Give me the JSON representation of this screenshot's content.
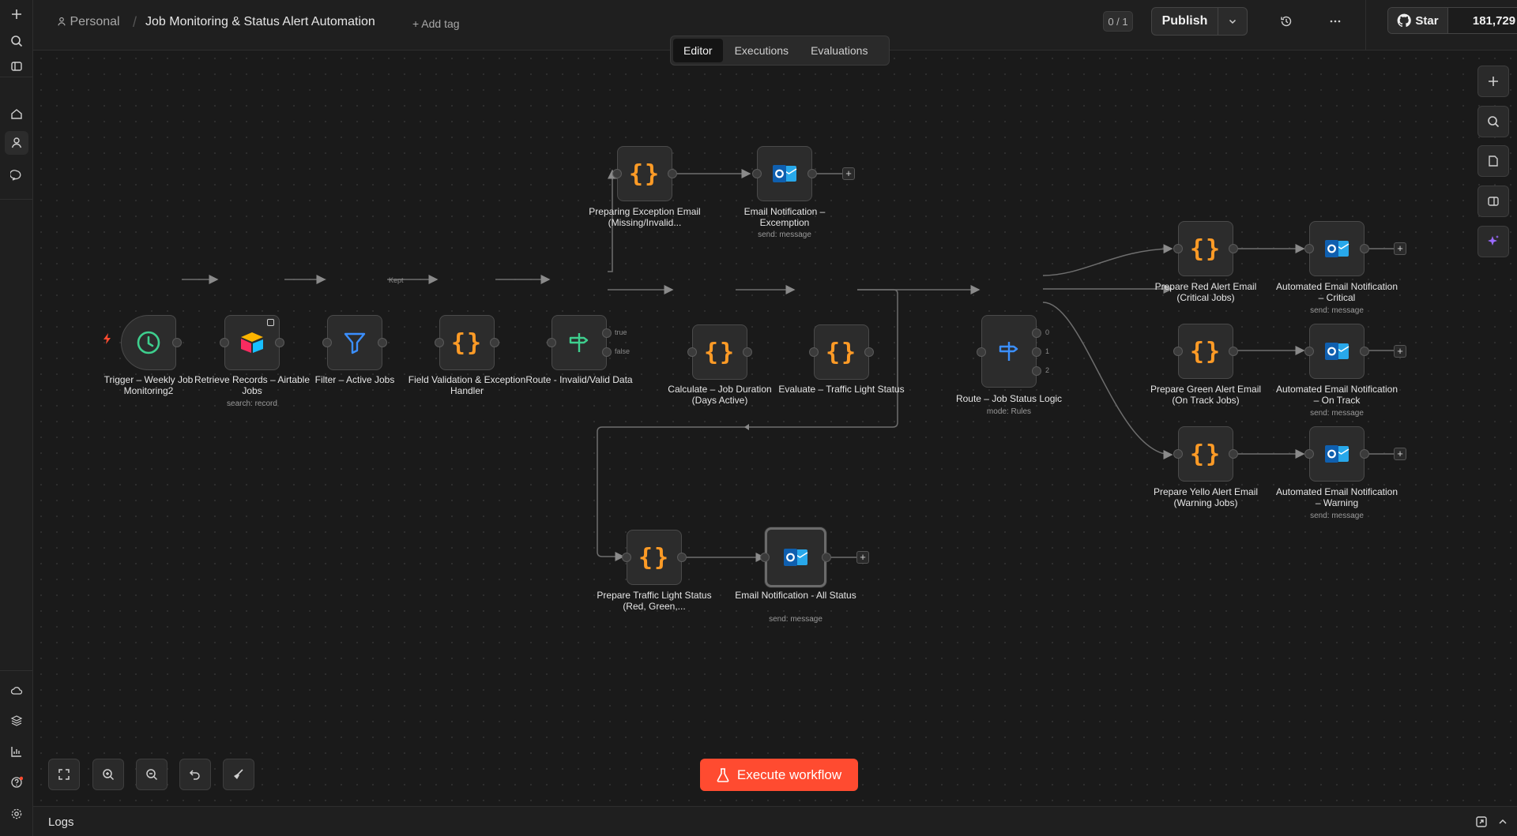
{
  "breadcrumb": {
    "project": "Personal",
    "separator": "/",
    "workflow_title": "Job Monitoring & Status Alert Automation",
    "add_tag": "+ Add tag"
  },
  "header": {
    "counter": "0 / 1",
    "publish_label": "Publish",
    "github_star_label": "Star",
    "github_star_count": "181,729"
  },
  "tabs": [
    {
      "label": "Editor",
      "active": true
    },
    {
      "label": "Executions"
    },
    {
      "label": "Evaluations"
    }
  ],
  "nodes": {
    "trigger": {
      "label": "Trigger – Weekly Job Monitoring2",
      "icon": "clock-icon"
    },
    "retrieve": {
      "label": "Retrieve Records – Airtable Jobs",
      "sub": "search: record",
      "icon": "airtable-icon"
    },
    "filter": {
      "label": "Filter – Active Jobs",
      "icon": "filter-icon"
    },
    "validation": {
      "label": "Field Validation & Exception Handler",
      "icon": "code-icon"
    },
    "route_valid": {
      "label": "Route - Invalid/Valid Data",
      "icon": "route-icon",
      "out_true": "true",
      "out_false": "false"
    },
    "prep_exception": {
      "label": "Preparing Exception Email (Missing/Invalid...",
      "icon": "code-icon"
    },
    "email_exception": {
      "label": "Email Notification – Excemption",
      "sub": "send: message",
      "icon": "outlook-icon"
    },
    "calc_duration": {
      "label": "Calculate – Job Duration (Days Active)",
      "icon": "code-icon"
    },
    "evaluate": {
      "label": "Evaluate – Traffic Light Status",
      "icon": "code-icon"
    },
    "route_status": {
      "label": "Route – Job Status Logic",
      "sub": "mode: Rules",
      "icon": "route-icon",
      "out_0": "0",
      "out_1": "1",
      "out_2": "2"
    },
    "prep_red": {
      "label": "Prepare Red Alert Email (Critical Jobs)",
      "icon": "code-icon"
    },
    "email_critical": {
      "label": "Automated Email Notification – Critical",
      "sub": "send: message",
      "icon": "outlook-icon"
    },
    "prep_green": {
      "label": "Prepare Green Alert Email (On Track Jobs)",
      "icon": "code-icon"
    },
    "email_ontrack": {
      "label": "Automated Email Notification – On Track",
      "sub": "send: message",
      "icon": "outlook-icon"
    },
    "prep_yellow": {
      "label": "Prepare Yello Alert Email (Warning Jobs)",
      "icon": "code-icon"
    },
    "email_warning": {
      "label": "Automated Email Notification – Warning",
      "sub": "send: message",
      "icon": "outlook-icon"
    },
    "prep_traffic": {
      "label": "Prepare Traffic Light Status (Red, Green,...",
      "icon": "code-icon"
    },
    "email_all": {
      "label": "Email Notification - All Status",
      "sub": "send: message",
      "icon": "outlook-icon"
    }
  },
  "edge_labels": {
    "kept": "Kept"
  },
  "execute_label": "Execute workflow",
  "logs_label": "Logs",
  "colors": {
    "accent": "#ff4b30",
    "code": "#ff9b26",
    "trigger": "#3ecf8e",
    "filter": "#3b8fff",
    "route_green": "#3ecf8e",
    "route_blue": "#3b8fff",
    "outlook": "#1f6fc2"
  }
}
